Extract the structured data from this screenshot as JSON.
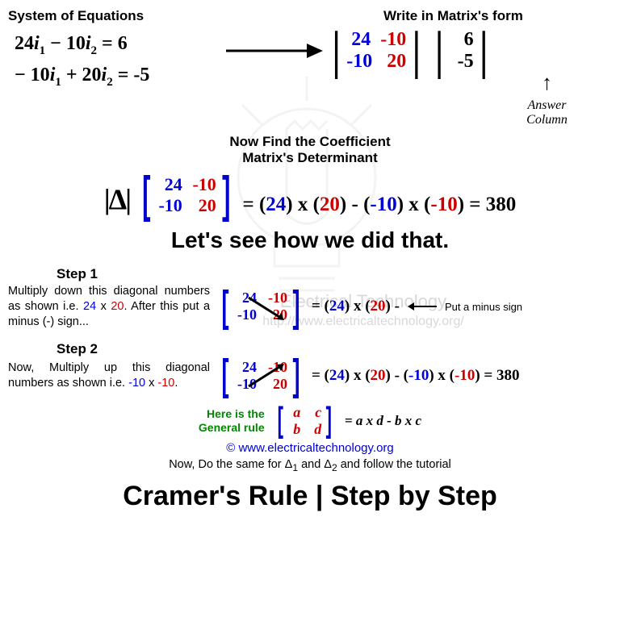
{
  "headers": {
    "system": "System of Equations",
    "matrixform": "Write in Matrix's form",
    "nowfind": "Now Find the Coefficient Matrix's Determinant",
    "answercol1": "Answer",
    "answercol2": "Column"
  },
  "equations": {
    "r1_c1": "24",
    "r1_i1": "i",
    "r1_sub1": "1",
    "r1_op": " − 10",
    "r1_i2": "i",
    "r1_sub2": "2",
    "r1_rhs": " =   6",
    "r2_c1": "− 10",
    "r2_i1": "i",
    "r2_sub1": "1",
    "r2_op": " + 20",
    "r2_i2": "i",
    "r2_sub2": "2",
    "r2_rhs": " = -5"
  },
  "matA": {
    "a11": "24",
    "a12": "-10",
    "a21": "-10",
    "a22": "20"
  },
  "matB": {
    "b1": "6",
    "b2": "-5"
  },
  "delta": {
    "sym": "|Δ|",
    "eq": " = ",
    "expr1": "(24) x (20) - (-10) x (-10)",
    "res": " = 380",
    "eq2": "= (24) x (20) - (-10) x (-10) = 380"
  },
  "lets": "Let's see how we did that.",
  "step1": {
    "h": "Step 1",
    "text_pre": "Multiply down this diagonal numbers as shown i.e. ",
    "n1": "24",
    "x": " x ",
    "n2": "20",
    "text_post": ". After this put a minus (-) sign...",
    "rhs_a": "(24)",
    "rhs_x1": " x ",
    "rhs_b": "(20)",
    "rhs_m": " - ",
    "put": "Put a minus sign"
  },
  "step2": {
    "h": "Step 2",
    "text_pre": "Now, Multiply up this diagonal numbers as shown i.e. ",
    "n1": "-10",
    "x": " x ",
    "n2": "-10",
    "text_post": ".",
    "rhs": " = (24) x (20) - (-10) x (-10) = 380"
  },
  "general": {
    "label1": "Here is the",
    "label2": "General rule",
    "a": "a",
    "c": "c",
    "b": "b",
    "d": "d",
    "eq": " = a x d - b x c"
  },
  "copy": "© www.electricaltechnology.org",
  "nowdo_pre": "Now, Do the same for Δ",
  "nowdo_s1": "1",
  "nowdo_mid": " and Δ",
  "nowdo_s2": "2",
  "nowdo_post": " and follow the tutorial",
  "title": "Cramer's Rule | Step by Step",
  "wm1": "Electrical Technology",
  "wm2": "http://www.electricaltechnology.org/",
  "chart_data": {
    "type": "table",
    "coeff_matrix": [
      [
        24,
        -10
      ],
      [
        -10,
        20
      ]
    ],
    "constants": [
      6,
      -5
    ],
    "determinant": 380,
    "formula": "(24)(20) - (-10)(-10) = 380",
    "general_rule": "det([[a,c],[b,d]]) = a*d - b*c"
  }
}
